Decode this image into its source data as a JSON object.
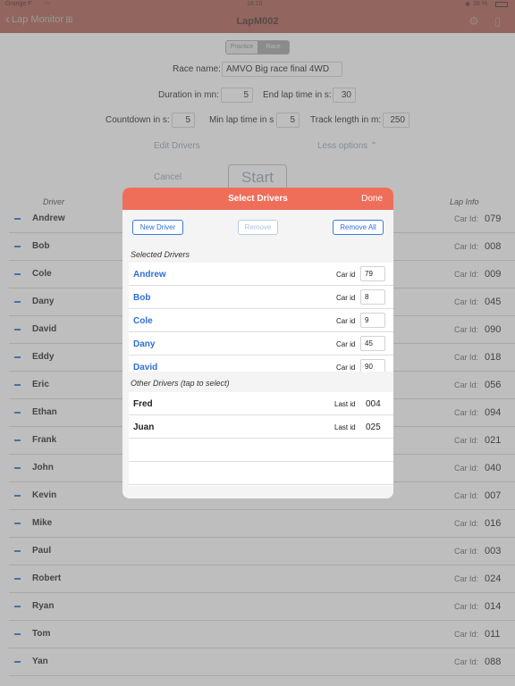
{
  "status": {
    "carrier": "Orange F",
    "time": "16:10",
    "battery": "38 %"
  },
  "nav": {
    "back_label": "Lap Monitor",
    "title": "LapM002"
  },
  "mode": {
    "practice": "Practice",
    "race": "Race"
  },
  "form": {
    "race_name_label": "Race name:",
    "race_name": "AMVO Big race final 4WD",
    "duration_label": "Duration in mn:",
    "duration": "5",
    "end_lap_label": "End lap time in s:",
    "end_lap": "30",
    "countdown_label": "Countdown in s:",
    "countdown": "5",
    "min_lap_label": "Min lap time in s",
    "min_lap": "5",
    "track_label": "Track length in m:",
    "track": "250",
    "edit_drivers": "Edit Drivers",
    "less_options": "Less options ⌃",
    "cancel": "Cancel",
    "start": "Start"
  },
  "list_header": {
    "driver": "Driver",
    "lap_info": "Lap Info"
  },
  "car_id_label": "Car Id:",
  "drivers": [
    {
      "name": "Andrew",
      "car": "079"
    },
    {
      "name": "Bob",
      "car": "008"
    },
    {
      "name": "Cole",
      "car": "009"
    },
    {
      "name": "Dany",
      "car": "045"
    },
    {
      "name": "David",
      "car": "090"
    },
    {
      "name": "Eddy",
      "car": "018"
    },
    {
      "name": "Eric",
      "car": "056"
    },
    {
      "name": "Ethan",
      "car": "094"
    },
    {
      "name": "Frank",
      "car": "021"
    },
    {
      "name": "John",
      "car": "040"
    },
    {
      "name": "Kevin",
      "car": "007"
    },
    {
      "name": "Mike",
      "car": "016"
    },
    {
      "name": "Paul",
      "car": "003"
    },
    {
      "name": "Robert",
      "car": "024"
    },
    {
      "name": "Ryan",
      "car": "014"
    },
    {
      "name": "Tom",
      "car": "011"
    },
    {
      "name": "Yan",
      "car": "088"
    }
  ],
  "modal": {
    "title": "Select Drivers",
    "done": "Done",
    "new_driver": "New Driver",
    "remove": "Remove",
    "remove_all": "Remove All",
    "selected_title": "Selected Drivers",
    "car_id_label": "Car id",
    "selected": [
      {
        "name": "Andrew",
        "car": "79"
      },
      {
        "name": "Bob",
        "car": "8"
      },
      {
        "name": "Cole",
        "car": "9"
      },
      {
        "name": "Dany",
        "car": "45"
      },
      {
        "name": "David",
        "car": "90"
      }
    ],
    "others_title": "Other Drivers (tap to select)",
    "last_id_label": "Last id",
    "others": [
      {
        "name": "Fred",
        "last": "004"
      },
      {
        "name": "Juan",
        "last": "025"
      }
    ]
  }
}
